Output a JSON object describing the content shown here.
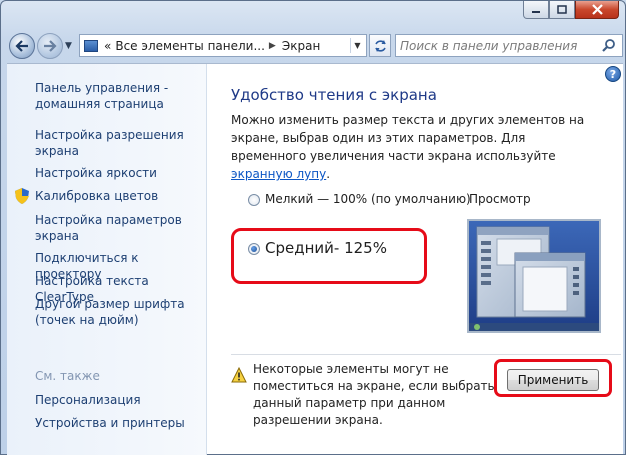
{
  "window": {
    "caption_buttons": [
      "minimize-icon",
      "maximize-icon",
      "close-icon"
    ]
  },
  "nav": {
    "address_segments": [
      "Все элементы панели...",
      "Экран"
    ],
    "search_placeholder": "Поиск в панели управления"
  },
  "sidebar": {
    "items": [
      {
        "label": "Панель управления - домашняя страница"
      },
      {
        "label": "Настройка разрешения экрана"
      },
      {
        "label": "Настройка яркости"
      },
      {
        "label": "Калибровка цветов",
        "icon": "shield-icon"
      },
      {
        "label": "Настройка параметров экрана"
      },
      {
        "label": "Подключиться к проектору"
      },
      {
        "label": "Настройка текста ClearType"
      },
      {
        "label": "Другой размер шрифта (точек на дюйм)"
      }
    ],
    "see_also_label": "См. также",
    "see_also_items": [
      {
        "label": "Персонализация"
      },
      {
        "label": "Устройства и принтеры"
      }
    ]
  },
  "main": {
    "title": "Удобство чтения с экрана",
    "description": "Можно изменить размер текста и других элементов на экране, выбрав один из этих параметров. Для временного увеличения части экрана используйте",
    "link_text": "экранную лупу",
    "description_end": ".",
    "options": [
      {
        "label": "Мелкий — 100% (по умолчанию)",
        "checked": false
      },
      {
        "label": "Средний- 125%",
        "checked": true
      }
    ],
    "preview_label": "Просмотр",
    "warning_text": "Некоторые элементы могут не поместиться на экране, если выбрать данный параметр при данном разрешении экрана.",
    "apply_label": "Применить",
    "highlight_color": "#e60b18"
  }
}
